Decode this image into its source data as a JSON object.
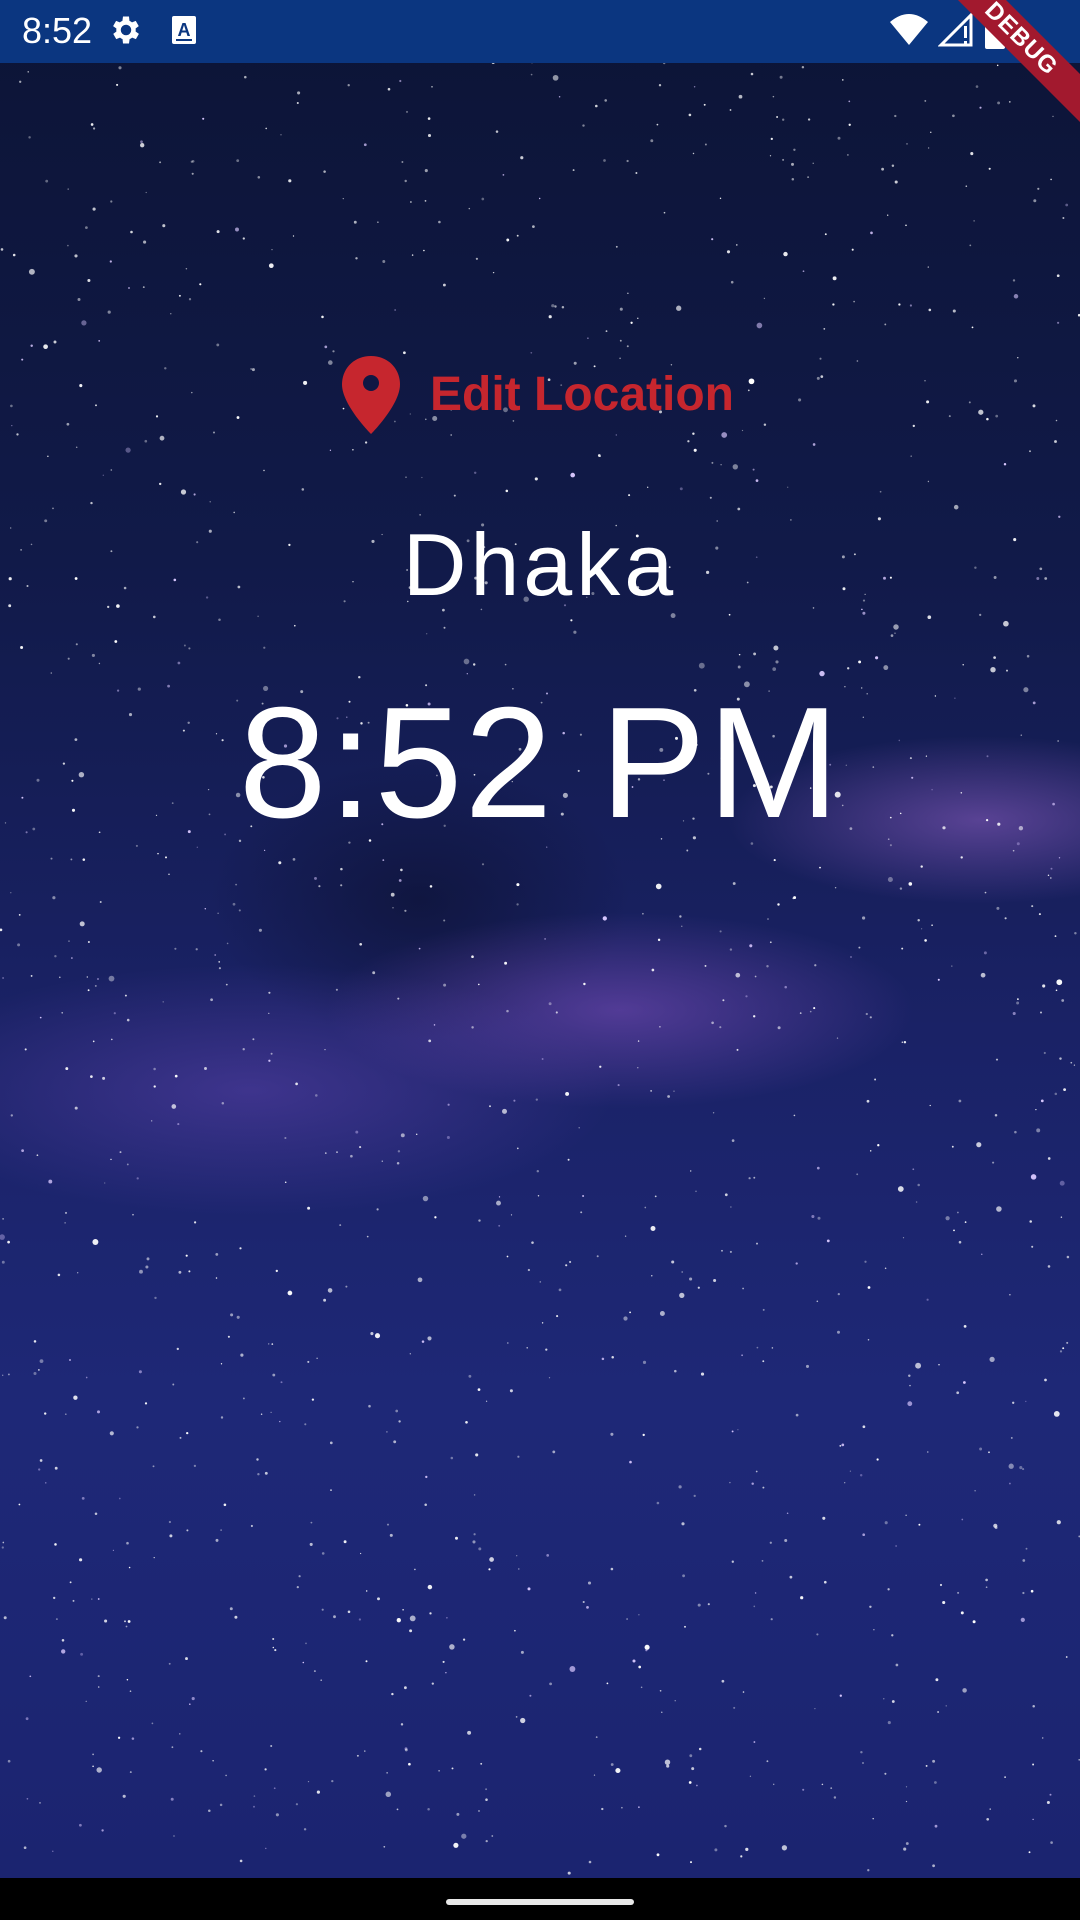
{
  "status_bar": {
    "time": "8:52",
    "icons": [
      "gear-icon",
      "a-keyboard-icon",
      "wifi-icon",
      "signal-icon",
      "battery-icon"
    ],
    "background": "#0b3680"
  },
  "debug_ribbon": {
    "label": "DEBUG",
    "color": "#a2192e"
  },
  "main": {
    "edit_location_label": "Edit Location",
    "edit_location_icon": "location-pin-icon",
    "accent": "#c6262e",
    "city": "Dhaka",
    "time": "8:52 PM"
  },
  "background": {
    "theme": "night-sky-milky-way"
  }
}
